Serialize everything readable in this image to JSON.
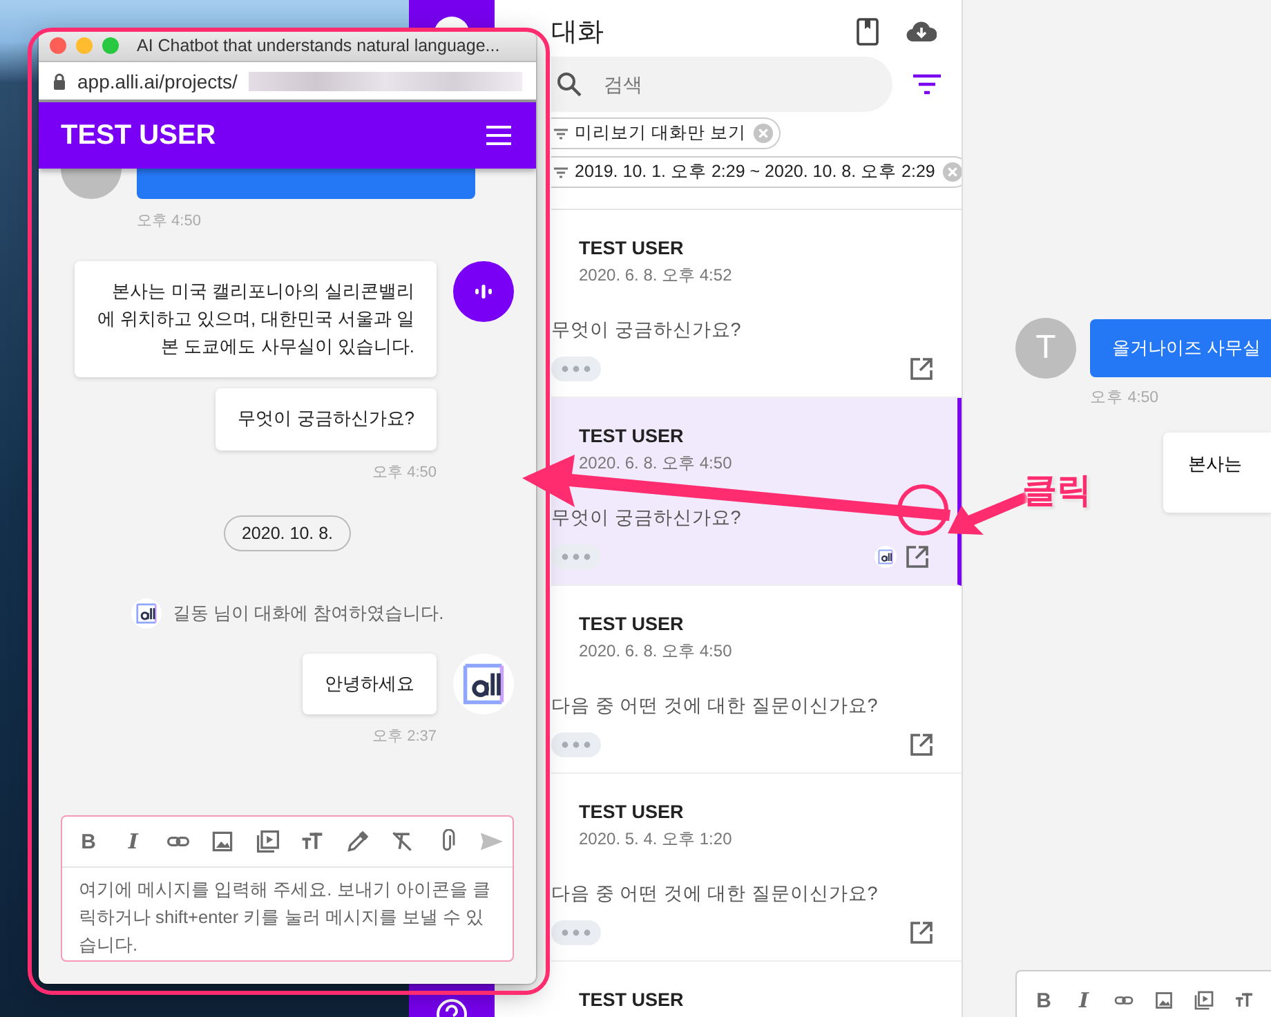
{
  "popup_window": {
    "title": "AI Chatbot that understands natural language...",
    "url": "app.alli.ai/projects/",
    "header_title": "TEST USER",
    "messages": [
      {
        "kind": "user"
      },
      {
        "kind": "time",
        "text": "오후 4:50"
      },
      {
        "kind": "bot",
        "text": "본사는 미국 캘리포니아의 실리콘밸리에 위치하고 있으며, 대한민국 서울과 일본 도쿄에도 사무실이 있습니다.",
        "avatar": true
      },
      {
        "kind": "bot",
        "text": "무엇이 궁금하신가요?",
        "avatar": false
      },
      {
        "kind": "time",
        "text": "오후 4:50"
      },
      {
        "kind": "date",
        "text": "2020. 10. 8."
      },
      {
        "kind": "system",
        "text": "길동 님이 대화에 참여하였습니다."
      },
      {
        "kind": "agent",
        "text": "안녕하세요",
        "avatar": true
      },
      {
        "kind": "time",
        "text": "오후 2:37"
      }
    ],
    "composer": {
      "toolbar": [
        {
          "kind": "bold",
          "label": "B"
        },
        {
          "kind": "italic",
          "label": "I"
        },
        {
          "kind": "link"
        },
        {
          "kind": "image"
        },
        {
          "kind": "video"
        },
        {
          "kind": "size"
        },
        {
          "kind": "picker"
        },
        {
          "kind": "clear"
        },
        {
          "kind": "attach"
        },
        {
          "kind": "send"
        }
      ],
      "placeholder": "여기에 메시지를 입력해 주세요. 보내기 아이콘을 클릭하거나 shift+enter 키를 눌러 메시지를 보낼 수 있습니다."
    }
  },
  "conversation_list": {
    "title": "대화",
    "search_placeholder": "검색",
    "filters": [
      {
        "text": "미리보기 대화만 보기"
      },
      {
        "text": "2019. 10. 1. 오후 2:29 ~ 2020. 10. 8. 오후 2:29"
      }
    ],
    "items": [
      {
        "name": "TEST USER",
        "date": "2020. 6. 8. 오후 4:52",
        "preview": "무엇이 궁금하신가요?",
        "selected": false,
        "agent": false
      },
      {
        "name": "TEST USER",
        "date": "2020. 6. 8. 오후 4:50",
        "preview": "무엇이 궁금하신가요?",
        "selected": true,
        "agent": true
      },
      {
        "name": "TEST USER",
        "date": "2020. 6. 8. 오후 4:50",
        "preview": "다음 중 어떤 것에 대한 질문이신가요?",
        "selected": false,
        "agent": false
      },
      {
        "name": "TEST USER",
        "date": "2020. 5. 4. 오후 1:20",
        "preview": "다음 중 어떤 것에 대한 질문이신가요?",
        "selected": false,
        "agent": false
      },
      {
        "name": "TEST USER",
        "selected": false
      }
    ]
  },
  "chat_preview": {
    "messages": [
      {
        "kind": "user",
        "avatar": "T",
        "text": "올거나이즈 사무실"
      },
      {
        "kind": "time",
        "text": "오후 4:50"
      },
      {
        "kind": "bot",
        "text": "본사는"
      }
    ],
    "toolbar": [
      {
        "kind": "bold",
        "label": "B"
      },
      {
        "kind": "italic",
        "label": "I"
      },
      {
        "kind": "link"
      },
      {
        "kind": "image"
      },
      {
        "kind": "video"
      },
      {
        "kind": "size"
      }
    ]
  },
  "annotation": {
    "label": "클릭"
  }
}
